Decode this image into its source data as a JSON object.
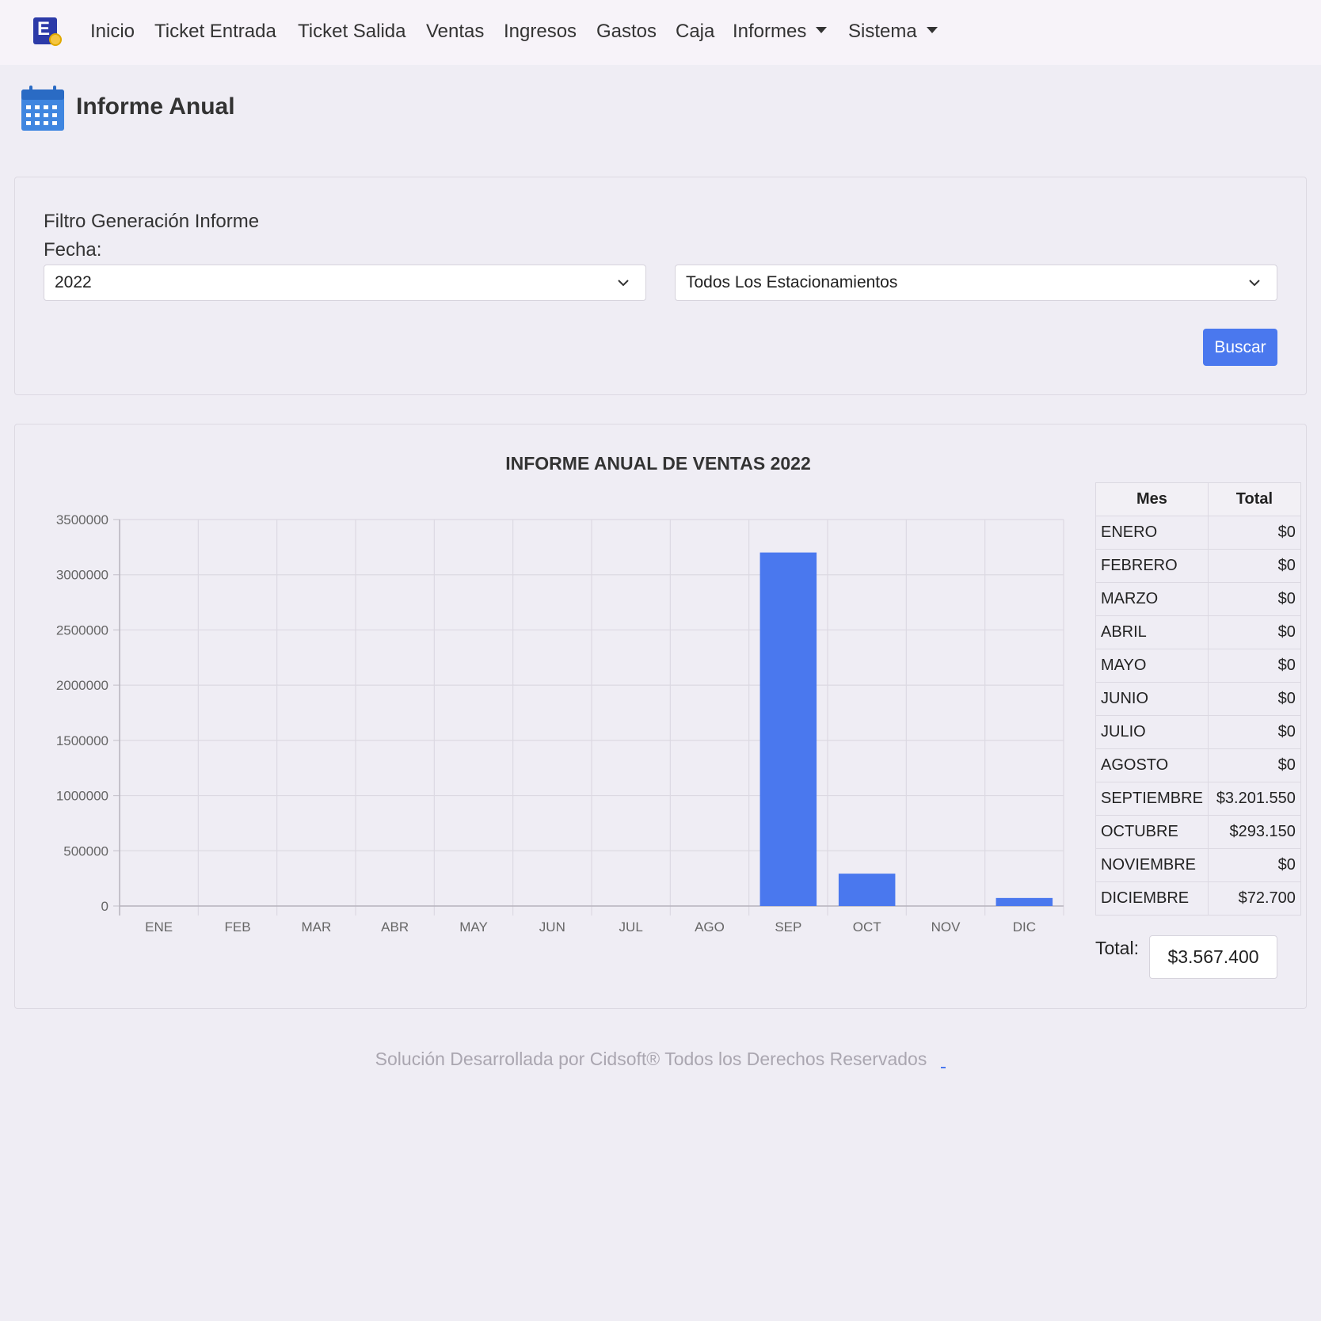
{
  "nav": {
    "items": [
      "Inicio",
      "Ticket Entrada",
      "Ticket Salida",
      "Ventas",
      "Ingresos",
      "Gastos",
      "Caja",
      "Informes",
      "Sistema"
    ],
    "logo_letter": "E"
  },
  "page": {
    "title": "Informe Anual"
  },
  "filter": {
    "title": "Filtro Generación Informe",
    "fecha_label": "Fecha:",
    "year_value": "2022",
    "parking_value": "Todos Los Estacionamientos",
    "search_label": "Buscar"
  },
  "colors": {
    "accent": "#4a78ee",
    "bar": "#4a78ee"
  },
  "chart_data": {
    "type": "bar",
    "title": "INFORME ANUAL DE VENTAS 2022",
    "categories": [
      "ENE",
      "FEB",
      "MAR",
      "ABR",
      "MAY",
      "JUN",
      "JUL",
      "AGO",
      "SEP",
      "OCT",
      "NOV",
      "DIC"
    ],
    "values": [
      0,
      0,
      0,
      0,
      0,
      0,
      0,
      0,
      3201550,
      293150,
      0,
      72700
    ],
    "ylim": [
      0,
      3500000
    ],
    "yticks": [
      "3500000",
      "3000000",
      "2500000",
      "2000000",
      "1500000",
      "1000000",
      "500000",
      "0"
    ],
    "grid": true
  },
  "table": {
    "headers": [
      "Mes",
      "Total"
    ],
    "rows": [
      [
        "ENERO",
        "$0"
      ],
      [
        "FEBRERO",
        "$0"
      ],
      [
        "MARZO",
        "$0"
      ],
      [
        "ABRIL",
        "$0"
      ],
      [
        "MAYO",
        "$0"
      ],
      [
        "JUNIO",
        "$0"
      ],
      [
        "JULIO",
        "$0"
      ],
      [
        "AGOSTO",
        "$0"
      ],
      [
        "SEPTIEMBRE",
        "$3.201.550"
      ],
      [
        "OCTUBRE",
        "$293.150"
      ],
      [
        "NOVIEMBRE",
        "$0"
      ],
      [
        "DICIEMBRE",
        "$72.700"
      ]
    ]
  },
  "total": {
    "label": "Total:",
    "value": "$3.567.400"
  },
  "footer": {
    "text": "Solución Desarrollada por Cidsoft® Todos los Derechos Reservados"
  }
}
